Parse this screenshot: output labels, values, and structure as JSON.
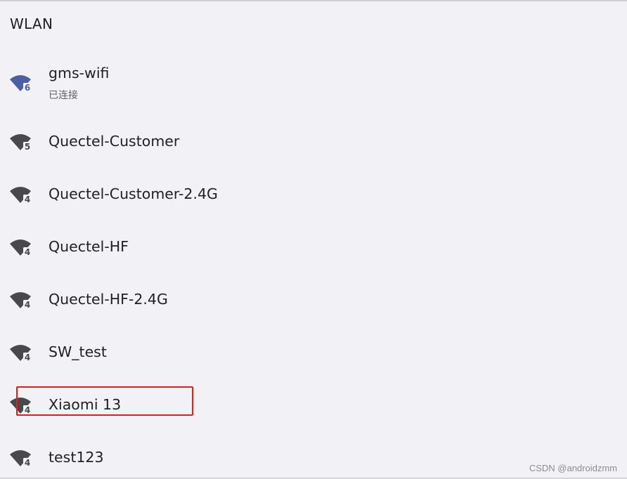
{
  "header": {
    "title": "WLAN"
  },
  "colors": {
    "background": "#f2f1f5",
    "connected_icon": "#4c5fa2",
    "icon": "#48484d",
    "highlight_border": "#e0201b"
  },
  "networks": [
    {
      "ssid": "gms-wifi",
      "status": "已连接",
      "badge": "6",
      "icon": "wifi-signal-connected-icon"
    },
    {
      "ssid": "Quectel-Customer",
      "badge": "5",
      "icon": "wifi-signal-icon"
    },
    {
      "ssid": "Quectel-Customer-2.4G",
      "badge": "4",
      "icon": "wifi-signal-icon"
    },
    {
      "ssid": "Quectel-HF",
      "badge": "4",
      "icon": "wifi-signal-icon"
    },
    {
      "ssid": "Quectel-HF-2.4G",
      "badge": "4",
      "icon": "wifi-signal-icon"
    },
    {
      "ssid": "SW_test",
      "badge": "4",
      "icon": "wifi-signal-icon"
    },
    {
      "ssid": "Xiaomi 13",
      "badge": "4",
      "icon": "wifi-signal-icon",
      "highlighted": true
    },
    {
      "ssid": "test123",
      "badge": "4",
      "icon": "wifi-signal-icon"
    }
  ],
  "watermark": "CSDN @androidzmm"
}
